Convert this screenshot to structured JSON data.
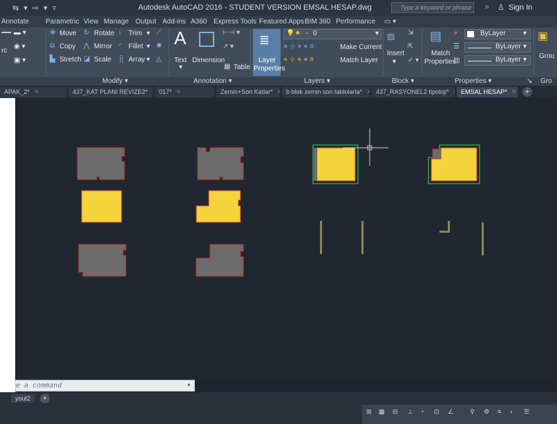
{
  "titlebar": {
    "quick_access": "⇆ ▾ ⇨ ▾ ▿",
    "title": "Autodesk AutoCAD 2016 - STUDENT VERSION    EMSAL HESAP.dwg",
    "search_placeholder": "Type a keyword or phrase",
    "sign_in": "Sign In"
  },
  "ribbon_tabs": [
    "Annotate",
    "Parametric",
    "View",
    "Manage",
    "Output",
    "Add-ins",
    "A360",
    "Express Tools",
    "Featured Apps",
    "BIM 360",
    "Performance"
  ],
  "ribbon": {
    "modify": {
      "move": "Move",
      "rotate": "Rotate",
      "trim": "Trim",
      "copy": "Copy",
      "mirror": "Mirror",
      "fillet": "Fillet",
      "stretch": "Stretch",
      "scale": "Scale",
      "array": "Array"
    },
    "annotation": {
      "text": "Text",
      "dimension": "Dimension",
      "table": "Table"
    },
    "layers": {
      "layer_properties_1": "Layer",
      "layer_properties_2": "Properties",
      "current_layer": "0",
      "make_current": "Make Current",
      "match_layer": "Match Layer"
    },
    "block": {
      "insert": "Insert"
    },
    "properties": {
      "match_1": "Match",
      "match_2": "Properties",
      "color": "ByLayer",
      "linetype": "ByLayer",
      "lineweight": "ByLayer"
    },
    "groups_label": "Grou"
  },
  "panel_titles": {
    "modify": "Modify ▾",
    "annotation": "Annotation ▾",
    "layers": "Layers ▾",
    "block": "Block ▾",
    "properties": "Properties ▾",
    "groups": "Gro"
  },
  "doc_tabs": [
    "APAK_2*",
    "437_KAT PLANI REVIZE2*",
    "017*",
    "Zemin+Son Katlar*",
    "b blok zemin son tablolarla*",
    "437_RASYONEL2 tipoloji*",
    "EMSAL HESAP*"
  ],
  "active_doc_tab": "EMSAL HESAP*",
  "command_line": {
    "prompt": "e a command"
  },
  "layout_tab": "yout2",
  "colors": {
    "canvas": "#212730",
    "hatch_gray": "#6e6e6e",
    "outline_red": "#c0392b",
    "fill_yellow": "#f5d33a",
    "outline_green": "#2ea043",
    "olive": "#8a8a4a"
  }
}
